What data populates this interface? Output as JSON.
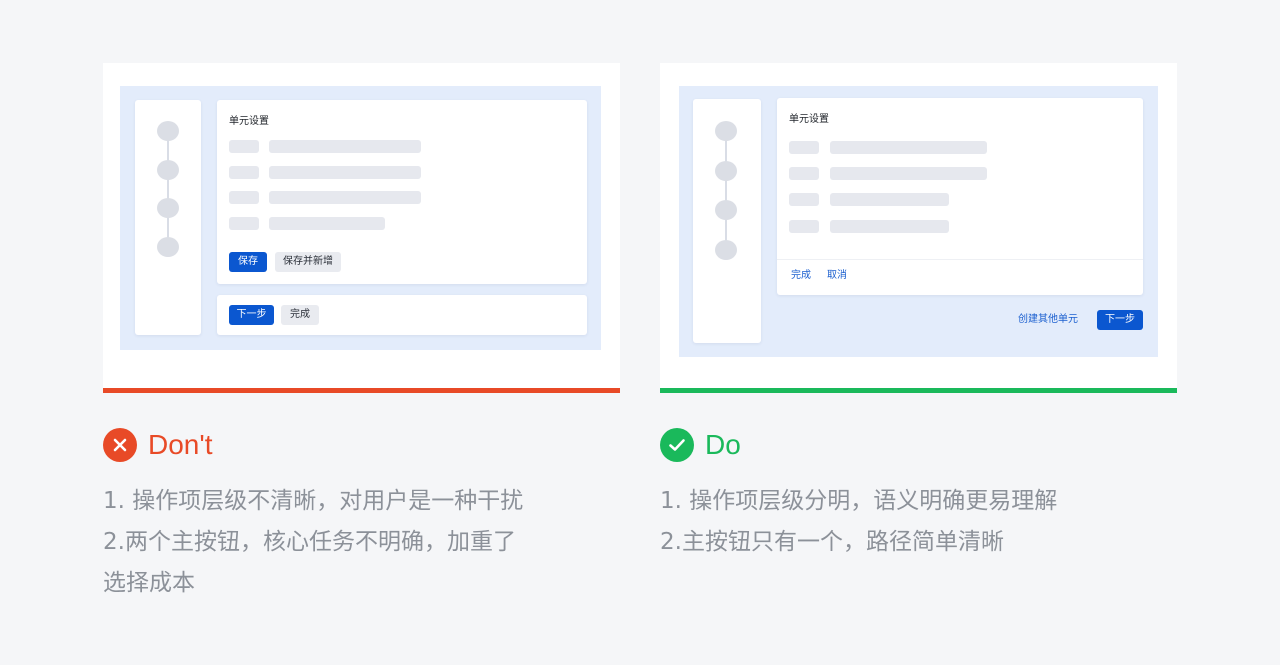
{
  "dont": {
    "card_title": "单元设置",
    "save_label": "保存",
    "save_and_add_label": "保存并新增",
    "next_label": "下一步",
    "finish_label": "完成",
    "verdict": "Don't",
    "verdict_color": "#e84a27",
    "lines": [
      "1. 操作项层级不清晰，对用户是一种干扰",
      "2.两个主按钮，核心任务不明确，加重了",
      "选择成本"
    ]
  },
  "do": {
    "card_title": "单元设置",
    "finish_label": "完成",
    "cancel_label": "取消",
    "create_other_label": "创建其他单元",
    "next_label": "下一步",
    "verdict": "Do",
    "verdict_color": "#1ab95b",
    "lines": [
      "1. 操作项层级分明，语义明确更易理解",
      "2.主按钮只有一个，路径简单清晰"
    ]
  },
  "colors": {
    "primary_button": "#0b57d0",
    "canvas_background": "#e3ecfb",
    "dont_accent": "#e84a27",
    "do_accent": "#1ab95b"
  },
  "icons": {
    "dont": "close-circle-icon",
    "do": "check-circle-icon"
  }
}
